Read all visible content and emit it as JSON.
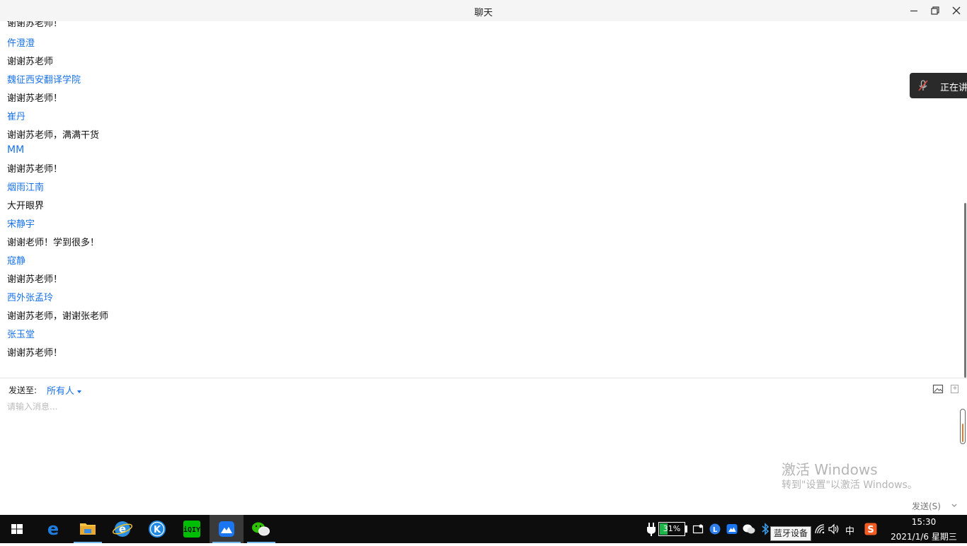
{
  "window": {
    "title": "聊天",
    "minimize_icon": "minimize-icon",
    "restore_icon": "restore-icon",
    "close_icon": "close-icon"
  },
  "messages": [
    {
      "kind": "text",
      "value": "谢谢苏老师！"
    },
    {
      "kind": "name",
      "value": "仵澄澄"
    },
    {
      "kind": "text",
      "value": "谢谢苏老师"
    },
    {
      "kind": "name",
      "value": "魏征西安翻译学院"
    },
    {
      "kind": "text",
      "value": "谢谢苏老师！"
    },
    {
      "kind": "name",
      "value": "崔丹"
    },
    {
      "kind": "text",
      "value": "谢谢苏老师，满满干货"
    },
    {
      "kind": "name",
      "value": "MM"
    },
    {
      "kind": "text",
      "value": "谢谢苏老师！"
    },
    {
      "kind": "name",
      "value": "烟雨江南"
    },
    {
      "kind": "text",
      "value": "大开眼界"
    },
    {
      "kind": "name",
      "value": "宋静宇"
    },
    {
      "kind": "text",
      "value": "谢谢老师！学到很多！"
    },
    {
      "kind": "name",
      "value": "寇静"
    },
    {
      "kind": "text",
      "value": "谢谢苏老师！"
    },
    {
      "kind": "name",
      "value": "西外张孟玲"
    },
    {
      "kind": "text",
      "value": "谢谢苏老师，谢谢张老师"
    },
    {
      "kind": "name",
      "value": "张玉堂"
    },
    {
      "kind": "text",
      "value": "谢谢苏老师！"
    }
  ],
  "speaking_toast": {
    "icon": "muted-mic-icon",
    "text": "正在讲"
  },
  "compose": {
    "send_to_label": "发送至:",
    "recipient": "所有人",
    "placeholder": "请输入消息...",
    "value": "",
    "send_label": "发送(S)",
    "image_icon": "image-icon",
    "screenshot_icon": "screenshot-icon",
    "send_options_icon": "chevron-down-icon"
  },
  "watermark": {
    "line1": "激活 Windows",
    "line2": "转到\"设置\"以激活 Windows。"
  },
  "taskbar": {
    "apps": [
      {
        "name": "start",
        "icon": "windows-start-icon"
      },
      {
        "name": "edge",
        "icon": "edge-icon"
      },
      {
        "name": "file-explorer",
        "icon": "folder-icon"
      },
      {
        "name": "ie",
        "icon": "ie-icon"
      },
      {
        "name": "kugou",
        "icon": "kugou-icon"
      },
      {
        "name": "iqiyi",
        "icon": "iqiyi-icon"
      },
      {
        "name": "meeting",
        "icon": "meeting-icon"
      },
      {
        "name": "wechat",
        "icon": "wechat-icon"
      }
    ],
    "battery_percent": "31%",
    "battery_level": 0.31,
    "ime": "中",
    "bluetooth_tooltip": "蓝牙设备",
    "time": "15:30",
    "date": "2021/1/6 星期三"
  }
}
